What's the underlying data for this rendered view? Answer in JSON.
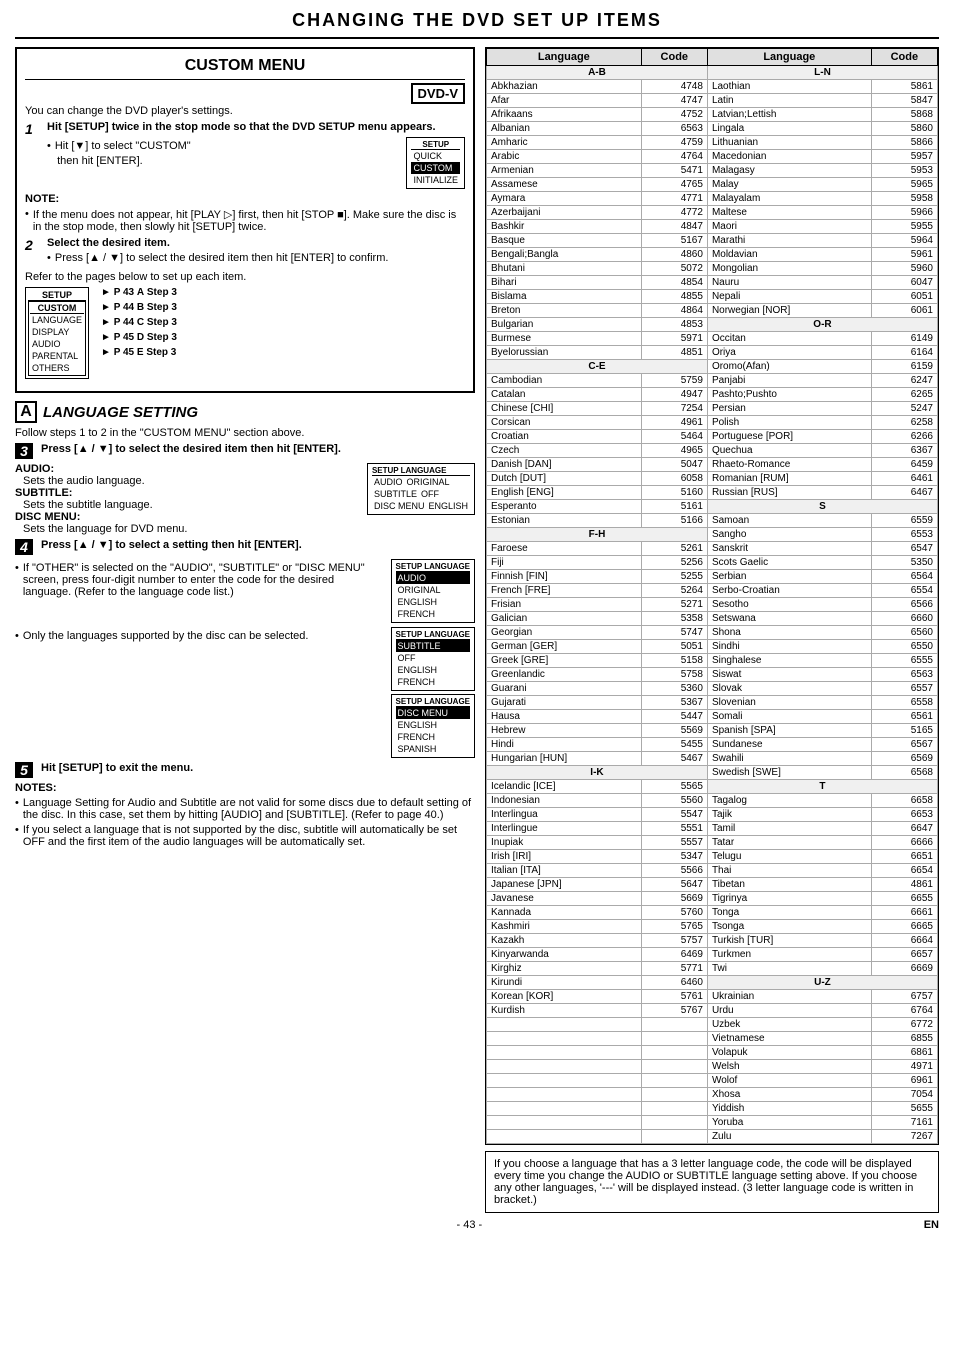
{
  "page": {
    "main_title": "CHANGING THE DVD SET UP ITEMS",
    "page_num": "- 43 -",
    "en_badge": "EN",
    "custom_menu": {
      "title": "CUSTOM MENU",
      "dvd_badge": "DVD-V",
      "intro_text": "You can change the DVD player's settings.",
      "step1_num": "1",
      "step1_text": "Hit [SETUP] twice in the stop mode so that the DVD SETUP menu appears.",
      "bullet1a": "Hit [▼] to select \"CUSTOM\"",
      "bullet1b": "then hit [ENTER].",
      "note_label": "NOTE:",
      "note1": "If the menu does not appear, hit [PLAY ▷] first, then hit [STOP ■]. Make sure the disc is in the stop mode, then slowly hit [SETUP] twice.",
      "step2_num": "2",
      "step2_text": "Select the desired item.",
      "bullet2a": "Press [▲ / ▼] to select the desired item then hit [ENTER] to confirm.",
      "refer_text": "Refer to the pages below to set up each item.",
      "diagram_items": [
        {
          "label": "LANGUAGE",
          "page": "P 43",
          "letter": "A",
          "step": "Step 3"
        },
        {
          "label": "DISPLAY",
          "page": "P 44",
          "letter": "B",
          "step": "Step 3"
        },
        {
          "label": "AUDIO",
          "page": "P 44",
          "letter": "C",
          "step": "Step 3"
        },
        {
          "label": "PARENTAL",
          "page": "P 45",
          "letter": "D",
          "step": "Step 3"
        },
        {
          "label": "OTHERS",
          "page": "P 45",
          "letter": "E",
          "step": "Step 3"
        }
      ],
      "section_a_letter": "A",
      "section_a_title": "LANGUAGE SETTING",
      "section_a_intro": "Follow steps 1 to 2 in the \"CUSTOM MENU\" section above.",
      "step3_num": "3",
      "step3_text": "Press [▲ / ▼] to select the desired item then hit [ENTER].",
      "audio_label": "AUDIO:",
      "audio_text": "Sets the audio language.",
      "subtitle_label": "SUBTITLE:",
      "subtitle_text": "Sets the subtitle language.",
      "disc_menu_label": "DISC MENU:",
      "disc_menu_text": "Sets the language for DVD menu.",
      "step4_num": "4",
      "step4_text": "Press [▲ / ▼] to select a setting then hit [ENTER].",
      "step4_bullet1": "If \"OTHER\" is selected on the \"AUDIO\", \"SUBTITLE\" or \"DISC MENU\" screen, press four-digit number to enter the code for the desired language. (Refer to the language code list.)",
      "step4_bullet2": "Only the languages supported by the disc can be selected.",
      "step5_num": "5",
      "step5_text": "Hit [SETUP] to exit the menu.",
      "notes_label": "NOTES:",
      "note_a": "Language Setting for Audio and Subtitle are not valid for some discs due to default setting of the disc. In this case, set them by hitting [AUDIO] and [SUBTITLE]. (Refer to page 40.)",
      "note_b": "If you select a language that is not supported by the disc, subtitle will automatically be set OFF and the first item of the audio languages will be automatically set."
    },
    "lang_table": {
      "col1_header": "Language",
      "col2_header": "Code",
      "col3_header": "Language",
      "col4_header": "Code",
      "sections": [
        {
          "divider": "A-B",
          "rows": [
            [
              "Abkhazian",
              "4748"
            ],
            [
              "Afar",
              "4747"
            ],
            [
              "Afrikaans",
              "4752"
            ],
            [
              "Albanian",
              "6563"
            ],
            [
              "Amharic",
              "4759"
            ],
            [
              "Arabic",
              "4764"
            ],
            [
              "Armenian",
              "5471"
            ],
            [
              "Assamese",
              "4765"
            ],
            [
              "Aymara",
              "4771"
            ],
            [
              "Azerbaijani",
              "4772"
            ],
            [
              "Bashkir",
              "4847"
            ],
            [
              "Basque",
              "5167"
            ],
            [
              "Bengali;Bangla",
              "4860"
            ],
            [
              "Bhutani",
              "5072"
            ],
            [
              "Bihari",
              "4854"
            ],
            [
              "Bislama",
              "4855"
            ],
            [
              "Breton",
              "4864"
            ],
            [
              "Bulgarian",
              "4853"
            ],
            [
              "Burmese",
              "5971"
            ],
            [
              "Byelorussian",
              "4851"
            ]
          ]
        },
        {
          "divider": "C-E",
          "rows": [
            [
              "Cambodian",
              "5759"
            ],
            [
              "Catalan",
              "4947"
            ],
            [
              "Chinese [CHI]",
              "7254"
            ],
            [
              "Corsican",
              "4961"
            ],
            [
              "Croatian",
              "5464"
            ],
            [
              "Czech",
              "4965"
            ],
            [
              "Danish [DAN]",
              "5047"
            ],
            [
              "Dutch [DUT]",
              "6058"
            ],
            [
              "English [ENG]",
              "5160"
            ],
            [
              "Esperanto",
              "5161"
            ],
            [
              "Estonian",
              "5166"
            ]
          ]
        },
        {
          "divider": "F-H",
          "rows": [
            [
              "Faroese",
              "5261"
            ],
            [
              "Fiji",
              "5256"
            ],
            [
              "Finnish [FIN]",
              "5255"
            ],
            [
              "French [FRE]",
              "5264"
            ],
            [
              "Frisian",
              "5271"
            ],
            [
              "Galician",
              "5358"
            ],
            [
              "Georgian",
              "5747"
            ],
            [
              "German [GER]",
              "5051"
            ],
            [
              "Greek [GRE]",
              "5158"
            ],
            [
              "Greenlandic",
              "5758"
            ],
            [
              "Guarani",
              "5360"
            ],
            [
              "Gujarati",
              "5367"
            ],
            [
              "Hausa",
              "5447"
            ],
            [
              "Hebrew",
              "5569"
            ],
            [
              "Hindi",
              "5455"
            ],
            [
              "Hungarian [HUN]",
              "5467"
            ]
          ]
        },
        {
          "divider": "I-K",
          "rows": [
            [
              "Icelandic [ICE]",
              "5565"
            ],
            [
              "Indonesian",
              "5560"
            ],
            [
              "Interlingua",
              "5547"
            ],
            [
              "Interlingue",
              "5551"
            ],
            [
              "Inupiak",
              "5557"
            ],
            [
              "Irish [IRI]",
              "5347"
            ],
            [
              "Italian [ITA]",
              "5566"
            ],
            [
              "Japanese [JPN]",
              "5647"
            ],
            [
              "Javanese",
              "5669"
            ],
            [
              "Kannada",
              "5760"
            ],
            [
              "Kashmiri",
              "5765"
            ],
            [
              "Kazakh",
              "5757"
            ],
            [
              "Kinyarwanda",
              "6469"
            ],
            [
              "Kirghiz",
              "5771"
            ],
            [
              "Kirundi",
              "6460"
            ],
            [
              "Korean [KOR]",
              "5761"
            ],
            [
              "Kurdish",
              "5767"
            ]
          ]
        }
      ],
      "right_sections": [
        {
          "divider": "L-N",
          "rows": [
            [
              "Laothian",
              "5861"
            ],
            [
              "Latin",
              "5847"
            ],
            [
              "Latvian;Lettish",
              "5868"
            ],
            [
              "Lingala",
              "5860"
            ],
            [
              "Lithuanian",
              "5866"
            ],
            [
              "Macedonian",
              "5957"
            ],
            [
              "Malagasy",
              "5953"
            ],
            [
              "Malay",
              "5965"
            ],
            [
              "Malayalam",
              "5958"
            ],
            [
              "Maltese",
              "5966"
            ],
            [
              "Maori",
              "5955"
            ],
            [
              "Marathi",
              "5964"
            ],
            [
              "Moldavian",
              "5961"
            ],
            [
              "Mongolian",
              "5960"
            ],
            [
              "Nauru",
              "6047"
            ],
            [
              "Nepali",
              "6051"
            ],
            [
              "Norwegian [NOR]",
              "6061"
            ]
          ]
        },
        {
          "divider": "O-R",
          "rows": [
            [
              "Occitan",
              "6149"
            ],
            [
              "Oriya",
              "6164"
            ],
            [
              "Oromo(Afan)",
              "6159"
            ],
            [
              "Panjabi",
              "6247"
            ],
            [
              "Pashto;Pushto",
              "6265"
            ],
            [
              "Persian",
              "5247"
            ],
            [
              "Polish",
              "6258"
            ],
            [
              "Portuguese [POR]",
              "6266"
            ],
            [
              "Quechua",
              "6367"
            ],
            [
              "Rhaeto-Romance",
              "6459"
            ],
            [
              "Romanian [RUM]",
              "6461"
            ],
            [
              "Russian [RUS]",
              "6467"
            ]
          ]
        },
        {
          "divider": "S",
          "rows": [
            [
              "Samoan",
              "6559"
            ],
            [
              "Sangho",
              "6553"
            ],
            [
              "Sanskrit",
              "6547"
            ],
            [
              "Scots Gaelic",
              "5350"
            ],
            [
              "Serbian",
              "6564"
            ],
            [
              "Serbo-Croatian",
              "6554"
            ],
            [
              "Sesotho",
              "6566"
            ],
            [
              "Setswana",
              "6660"
            ],
            [
              "Shona",
              "6560"
            ],
            [
              "Sindhi",
              "6550"
            ],
            [
              "Singhalese",
              "6555"
            ],
            [
              "Siswat",
              "6563"
            ],
            [
              "Slovak",
              "6557"
            ],
            [
              "Slovenian",
              "6558"
            ],
            [
              "Somali",
              "6561"
            ],
            [
              "Spanish [SPA]",
              "5165"
            ],
            [
              "Sundanese",
              "6567"
            ],
            [
              "Swahili",
              "6569"
            ],
            [
              "Swedish [SWE]",
              "6568"
            ]
          ]
        },
        {
          "divider": "T",
          "rows": [
            [
              "Tagalog",
              "6658"
            ],
            [
              "Tajik",
              "6653"
            ],
            [
              "Tamil",
              "6647"
            ],
            [
              "Tatar",
              "6666"
            ],
            [
              "Telugu",
              "6651"
            ],
            [
              "Thai",
              "6654"
            ],
            [
              "Tibetan",
              "4861"
            ],
            [
              "Tigrinya",
              "6655"
            ],
            [
              "Tonga",
              "6661"
            ],
            [
              "Tsonga",
              "6665"
            ],
            [
              "Turkish [TUR]",
              "6664"
            ],
            [
              "Turkmen",
              "6657"
            ],
            [
              "Twi",
              "6669"
            ]
          ]
        },
        {
          "divider": "U-Z",
          "rows": [
            [
              "Ukrainian",
              "6757"
            ],
            [
              "Urdu",
              "6764"
            ],
            [
              "Uzbek",
              "6772"
            ],
            [
              "Vietnamese",
              "6855"
            ],
            [
              "Volapuk",
              "6861"
            ],
            [
              "Welsh",
              "4971"
            ],
            [
              "Wolof",
              "6961"
            ],
            [
              "Xhosa",
              "7054"
            ],
            [
              "Yiddish",
              "5655"
            ],
            [
              "Yoruba",
              "7161"
            ],
            [
              "Zulu",
              "7267"
            ]
          ]
        }
      ],
      "bottom_note": "If you choose a language that has a 3 letter language code, the code will be displayed every time you change the AUDIO or SUBTITLE language setting above. If you choose any other languages, '---' will be displayed instead. (3 letter language code is written in bracket.)"
    },
    "setup_menu": {
      "title": "SETUP",
      "items": [
        "QUICK",
        "CUSTOM",
        "INITIALIZE"
      ],
      "custom_selected": true
    },
    "language_menu_audio": {
      "title1": "SETUP",
      "title2": "LANGUAGE",
      "items": [
        {
          "label": "AUDIO",
          "value": "ORIGINAL"
        },
        {
          "label": "SUBTITLE",
          "value": "OFF"
        },
        {
          "label": "DISC MENU",
          "value": "ENGLISH"
        }
      ]
    },
    "language_menu_audio2": {
      "title1": "SETUP",
      "title2": "LANGUAGE",
      "items": [
        {
          "label": "AUDIO",
          "selected": false
        },
        {
          "label": "ORIGINAL",
          "selected": true
        },
        {
          "label": "ENGLISH",
          "selected": false
        },
        {
          "label": "FRENCH",
          "selected": false
        }
      ]
    },
    "language_menu_subtitle": {
      "title1": "SETUP",
      "title2": "LANGUAGE",
      "items": [
        {
          "label": "SUBTITLE",
          "selected": false
        },
        {
          "label": "OFF",
          "selected": true
        },
        {
          "label": "ENGLISH",
          "selected": false
        },
        {
          "label": "FRENCH",
          "selected": false
        }
      ]
    },
    "language_menu_disc": {
      "title1": "SETUP",
      "title2": "LANGUAGE",
      "items": [
        {
          "label": "DISC MENU",
          "selected": false
        },
        {
          "label": "ENGLISH",
          "selected": true
        },
        {
          "label": "FRENCH",
          "selected": false
        },
        {
          "label": "SPANISH",
          "selected": false
        }
      ]
    }
  }
}
